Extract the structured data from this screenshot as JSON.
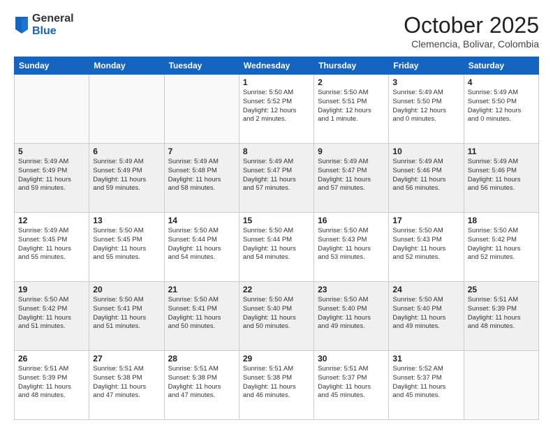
{
  "header": {
    "logo": {
      "general": "General",
      "blue": "Blue"
    },
    "title": "October 2025",
    "location": "Clemencia, Bolivar, Colombia"
  },
  "weekdays": [
    "Sunday",
    "Monday",
    "Tuesday",
    "Wednesday",
    "Thursday",
    "Friday",
    "Saturday"
  ],
  "weeks": [
    [
      {
        "day": "",
        "text": ""
      },
      {
        "day": "",
        "text": ""
      },
      {
        "day": "",
        "text": ""
      },
      {
        "day": "1",
        "text": "Sunrise: 5:50 AM\nSunset: 5:52 PM\nDaylight: 12 hours\nand 2 minutes."
      },
      {
        "day": "2",
        "text": "Sunrise: 5:50 AM\nSunset: 5:51 PM\nDaylight: 12 hours\nand 1 minute."
      },
      {
        "day": "3",
        "text": "Sunrise: 5:49 AM\nSunset: 5:50 PM\nDaylight: 12 hours\nand 0 minutes."
      },
      {
        "day": "4",
        "text": "Sunrise: 5:49 AM\nSunset: 5:50 PM\nDaylight: 12 hours\nand 0 minutes."
      }
    ],
    [
      {
        "day": "5",
        "text": "Sunrise: 5:49 AM\nSunset: 5:49 PM\nDaylight: 11 hours\nand 59 minutes."
      },
      {
        "day": "6",
        "text": "Sunrise: 5:49 AM\nSunset: 5:49 PM\nDaylight: 11 hours\nand 59 minutes."
      },
      {
        "day": "7",
        "text": "Sunrise: 5:49 AM\nSunset: 5:48 PM\nDaylight: 11 hours\nand 58 minutes."
      },
      {
        "day": "8",
        "text": "Sunrise: 5:49 AM\nSunset: 5:47 PM\nDaylight: 11 hours\nand 57 minutes."
      },
      {
        "day": "9",
        "text": "Sunrise: 5:49 AM\nSunset: 5:47 PM\nDaylight: 11 hours\nand 57 minutes."
      },
      {
        "day": "10",
        "text": "Sunrise: 5:49 AM\nSunset: 5:46 PM\nDaylight: 11 hours\nand 56 minutes."
      },
      {
        "day": "11",
        "text": "Sunrise: 5:49 AM\nSunset: 5:46 PM\nDaylight: 11 hours\nand 56 minutes."
      }
    ],
    [
      {
        "day": "12",
        "text": "Sunrise: 5:49 AM\nSunset: 5:45 PM\nDaylight: 11 hours\nand 55 minutes."
      },
      {
        "day": "13",
        "text": "Sunrise: 5:50 AM\nSunset: 5:45 PM\nDaylight: 11 hours\nand 55 minutes."
      },
      {
        "day": "14",
        "text": "Sunrise: 5:50 AM\nSunset: 5:44 PM\nDaylight: 11 hours\nand 54 minutes."
      },
      {
        "day": "15",
        "text": "Sunrise: 5:50 AM\nSunset: 5:44 PM\nDaylight: 11 hours\nand 54 minutes."
      },
      {
        "day": "16",
        "text": "Sunrise: 5:50 AM\nSunset: 5:43 PM\nDaylight: 11 hours\nand 53 minutes."
      },
      {
        "day": "17",
        "text": "Sunrise: 5:50 AM\nSunset: 5:43 PM\nDaylight: 11 hours\nand 52 minutes."
      },
      {
        "day": "18",
        "text": "Sunrise: 5:50 AM\nSunset: 5:42 PM\nDaylight: 11 hours\nand 52 minutes."
      }
    ],
    [
      {
        "day": "19",
        "text": "Sunrise: 5:50 AM\nSunset: 5:42 PM\nDaylight: 11 hours\nand 51 minutes."
      },
      {
        "day": "20",
        "text": "Sunrise: 5:50 AM\nSunset: 5:41 PM\nDaylight: 11 hours\nand 51 minutes."
      },
      {
        "day": "21",
        "text": "Sunrise: 5:50 AM\nSunset: 5:41 PM\nDaylight: 11 hours\nand 50 minutes."
      },
      {
        "day": "22",
        "text": "Sunrise: 5:50 AM\nSunset: 5:40 PM\nDaylight: 11 hours\nand 50 minutes."
      },
      {
        "day": "23",
        "text": "Sunrise: 5:50 AM\nSunset: 5:40 PM\nDaylight: 11 hours\nand 49 minutes."
      },
      {
        "day": "24",
        "text": "Sunrise: 5:50 AM\nSunset: 5:40 PM\nDaylight: 11 hours\nand 49 minutes."
      },
      {
        "day": "25",
        "text": "Sunrise: 5:51 AM\nSunset: 5:39 PM\nDaylight: 11 hours\nand 48 minutes."
      }
    ],
    [
      {
        "day": "26",
        "text": "Sunrise: 5:51 AM\nSunset: 5:39 PM\nDaylight: 11 hours\nand 48 minutes."
      },
      {
        "day": "27",
        "text": "Sunrise: 5:51 AM\nSunset: 5:38 PM\nDaylight: 11 hours\nand 47 minutes."
      },
      {
        "day": "28",
        "text": "Sunrise: 5:51 AM\nSunset: 5:38 PM\nDaylight: 11 hours\nand 47 minutes."
      },
      {
        "day": "29",
        "text": "Sunrise: 5:51 AM\nSunset: 5:38 PM\nDaylight: 11 hours\nand 46 minutes."
      },
      {
        "day": "30",
        "text": "Sunrise: 5:51 AM\nSunset: 5:37 PM\nDaylight: 11 hours\nand 45 minutes."
      },
      {
        "day": "31",
        "text": "Sunrise: 5:52 AM\nSunset: 5:37 PM\nDaylight: 11 hours\nand 45 minutes."
      },
      {
        "day": "",
        "text": ""
      }
    ]
  ]
}
